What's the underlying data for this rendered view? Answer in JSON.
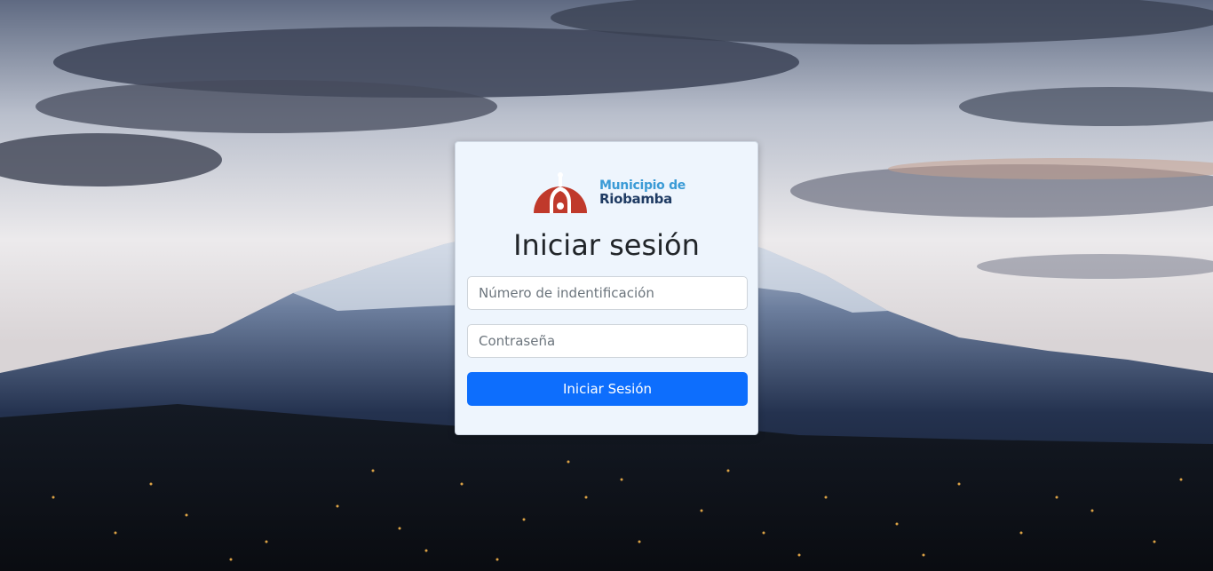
{
  "login": {
    "logo": {
      "line1": "Municipio de",
      "line2": "Riobamba"
    },
    "title": "Iniciar sesión",
    "id_field": {
      "placeholder": "Número de indentificación",
      "value": ""
    },
    "password_field": {
      "placeholder": "Contraseña",
      "value": ""
    },
    "submit_label": "Iniciar Sesión"
  },
  "colors": {
    "primary_button": "#0d6efd",
    "logo_red": "#c0392b",
    "logo_blue": "#3b9bd6",
    "logo_navy": "#1f3b63",
    "card_background": "#eef5fd"
  },
  "background": {
    "scene": "snow-capped volcano at dusk over city lights"
  }
}
